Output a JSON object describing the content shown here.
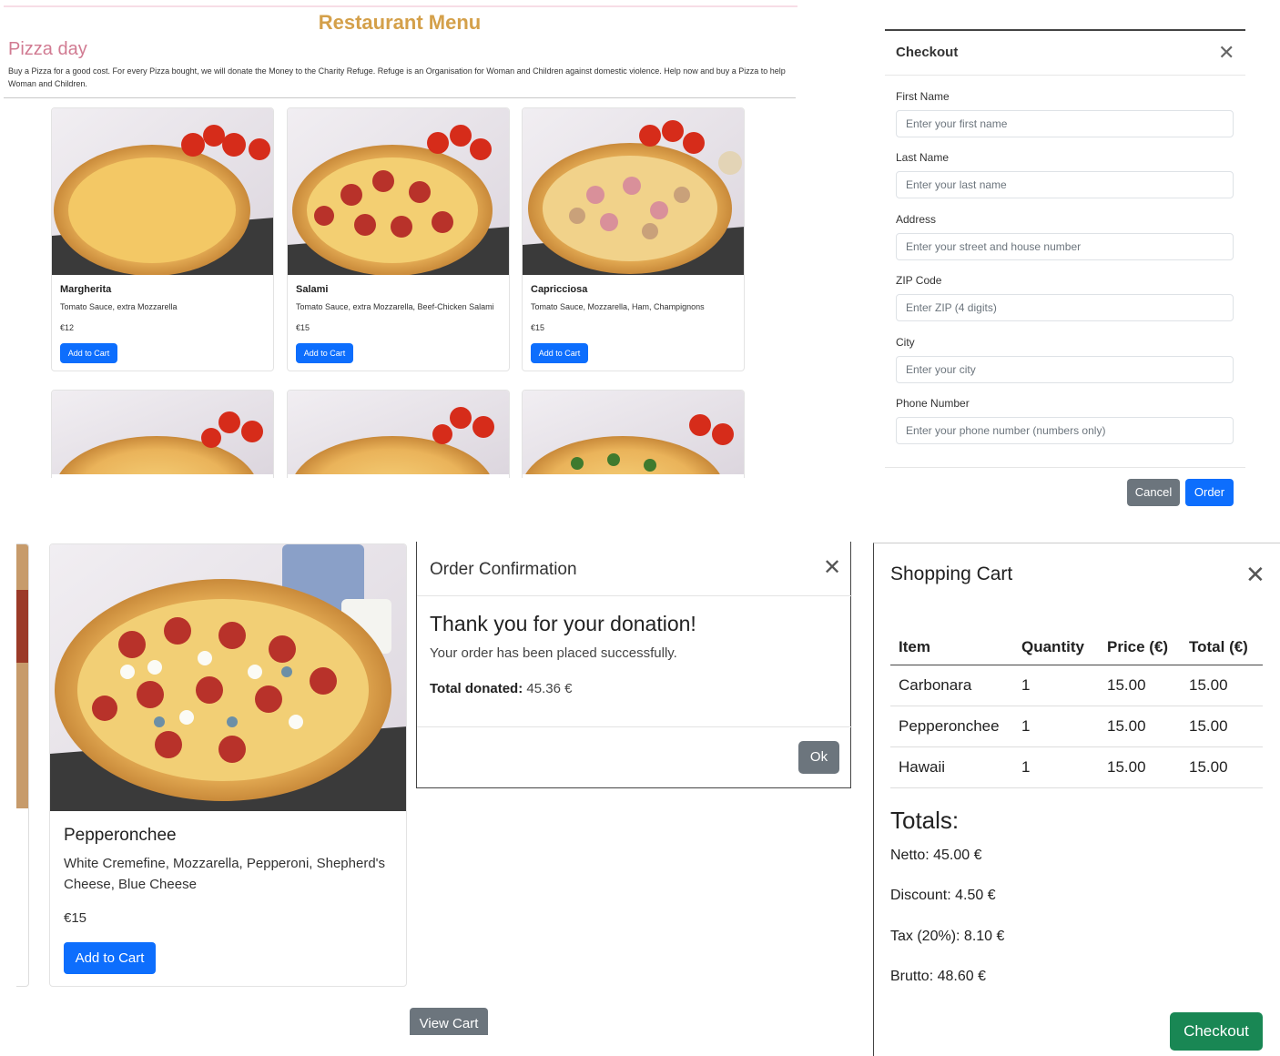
{
  "menu": {
    "title": "Restaurant Menu",
    "section_title": "Pizza day",
    "intro": "Buy a Pizza for a good cost. For every Pizza bought, we will donate the Money to the Charity Refuge. Refuge is an Organisation for Woman and Children against domestic violence. Help now and buy a Pizza to help Woman and Children.",
    "add_label": "Add to Cart",
    "items": [
      {
        "name": "Margherita",
        "desc": "Tomato Sauce, extra Mozzarella",
        "price": "€12"
      },
      {
        "name": "Salami",
        "desc": "Tomato Sauce, extra Mozzarella, Beef-Chicken Salami",
        "price": "€15"
      },
      {
        "name": "Capricciosa",
        "desc": "Tomato Sauce, Mozzarella, Ham, Champignons",
        "price": "€15"
      }
    ]
  },
  "checkout": {
    "title": "Checkout",
    "fields": [
      {
        "label": "First Name",
        "placeholder": "Enter your first name"
      },
      {
        "label": "Last Name",
        "placeholder": "Enter your last name"
      },
      {
        "label": "Address",
        "placeholder": "Enter your street and house number"
      },
      {
        "label": "ZIP Code",
        "placeholder": "Enter ZIP (4 digits)"
      },
      {
        "label": "City",
        "placeholder": "Enter your city"
      },
      {
        "label": "Phone Number",
        "placeholder": "Enter your phone number (numbers only)"
      }
    ],
    "cancel_label": "Cancel",
    "order_label": "Order"
  },
  "product": {
    "name": "Pepperonchee",
    "desc": "White Cremefine, Mozzarella, Pepperoni, Shepherd's Cheese, Blue Cheese",
    "price": "€15",
    "add_label": "Add to Cart",
    "view_cart_label": "View Cart"
  },
  "confirmation": {
    "title": "Order Confirmation",
    "heading": "Thank you for your donation!",
    "message": "Your order has been placed successfully.",
    "total_label": "Total donated:",
    "total_value": "45.36 €",
    "ok_label": "Ok"
  },
  "cart": {
    "title": "Shopping Cart",
    "headers": [
      "Item",
      "Quantity",
      "Price (€)",
      "Total (€)"
    ],
    "rows": [
      [
        "Carbonara",
        "1",
        "15.00",
        "15.00"
      ],
      [
        "Pepperonchee",
        "1",
        "15.00",
        "15.00"
      ],
      [
        "Hawaii",
        "1",
        "15.00",
        "15.00"
      ]
    ],
    "totals_heading": "Totals:",
    "netto": "Netto: 45.00 €",
    "discount": "Discount: 4.50 €",
    "tax": "Tax (20%): 8.10 €",
    "brutto": "Brutto: 48.60 €",
    "checkout_label": "Checkout"
  },
  "colors": {
    "primary": "#0d6efd",
    "secondary": "#6c757d",
    "success": "#198754",
    "menu_title": "#d4a04a",
    "section_title": "#d17b92"
  }
}
